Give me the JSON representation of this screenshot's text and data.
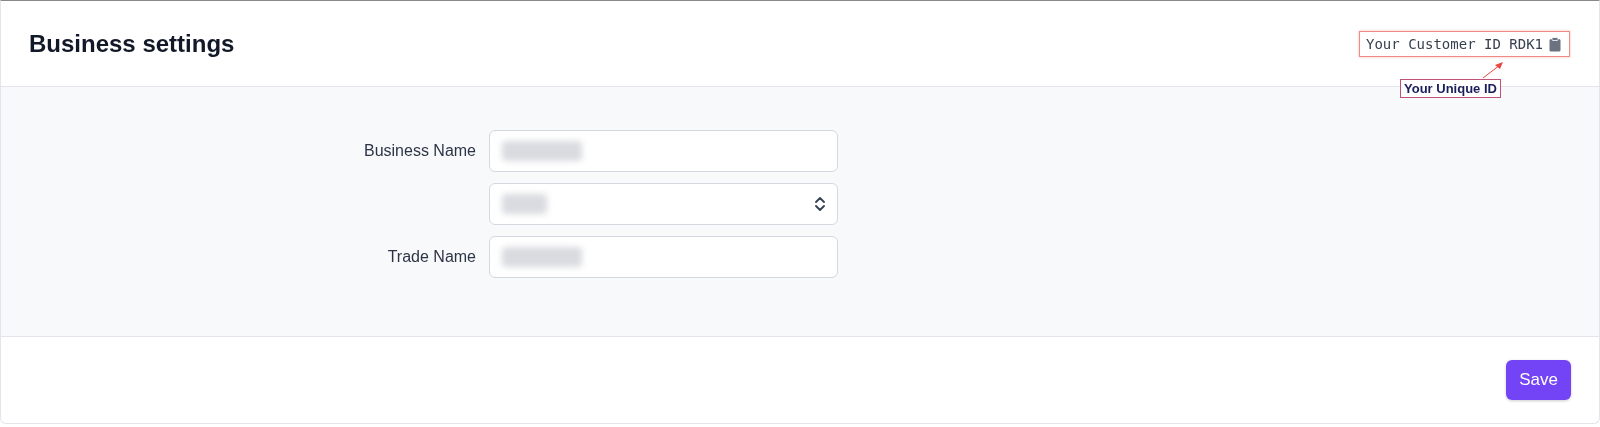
{
  "header": {
    "title": "Business settings",
    "customer_id": {
      "label": "Your Customer ID RDK1",
      "highlighted": true
    },
    "annotation": {
      "text": "Your Unique ID"
    }
  },
  "form": {
    "fields": [
      {
        "kind": "text",
        "label": "Business Name",
        "redacted": true
      },
      {
        "kind": "select",
        "redacted": true
      },
      {
        "kind": "text",
        "label": "Trade Name",
        "redacted": true
      }
    ]
  },
  "footer": {
    "buttons": [
      "Save"
    ]
  }
}
